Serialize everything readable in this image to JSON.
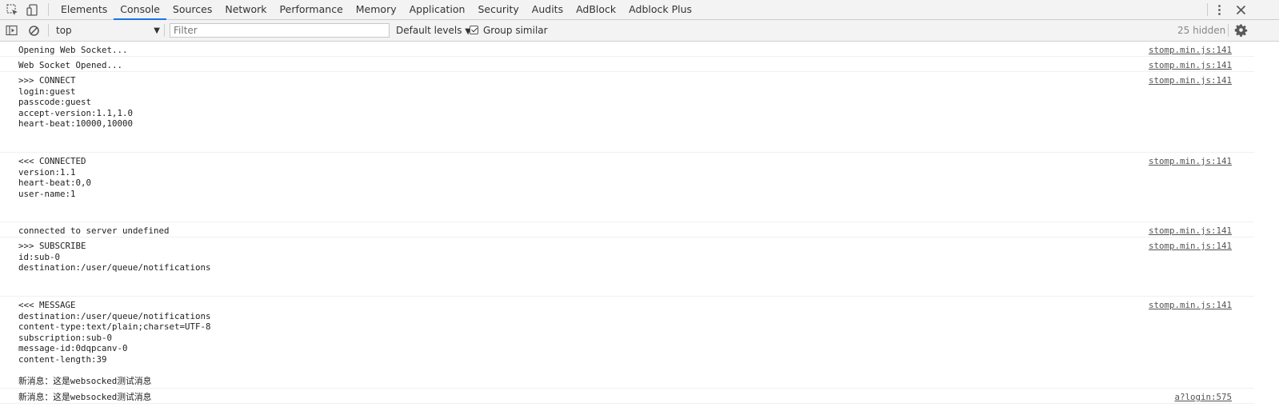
{
  "tabbar": {
    "tabs": [
      {
        "label": "Elements",
        "active": false
      },
      {
        "label": "Console",
        "active": true
      },
      {
        "label": "Sources",
        "active": false
      },
      {
        "label": "Network",
        "active": false
      },
      {
        "label": "Performance",
        "active": false
      },
      {
        "label": "Memory",
        "active": false
      },
      {
        "label": "Application",
        "active": false
      },
      {
        "label": "Security",
        "active": false
      },
      {
        "label": "Audits",
        "active": false
      },
      {
        "label": "AdBlock",
        "active": false
      },
      {
        "label": "Adblock Plus",
        "active": false
      }
    ],
    "icons": [
      "inspect-element-icon",
      "device-toolbar-icon",
      "kebab-menu-icon",
      "close-icon"
    ]
  },
  "toolbar": {
    "context": "top",
    "filter_placeholder": "Filter",
    "filter_value": "",
    "levels": "Default levels",
    "group_similar_label": "Group similar",
    "group_similar_checked": true,
    "hidden_count": "25 hidden",
    "icons": [
      "sidebar-toggle-icon",
      "clear-console-icon",
      "settings-gear-icon"
    ]
  },
  "messages": [
    {
      "text": "Opening Web Socket...",
      "source": "stomp.min.js:141"
    },
    {
      "text": "Web Socket Opened...",
      "source": "stomp.min.js:141"
    },
    {
      "text": ">>> CONNECT\nlogin:guest\npasscode:guest\naccept-version:1.1,1.0\nheart-beat:10000,10000",
      "source": "stomp.min.js:141"
    },
    {
      "text": "<<< CONNECTED\nversion:1.1\nheart-beat:0,0\nuser-name:1",
      "source": "stomp.min.js:141"
    },
    {
      "text": "connected to server undefined",
      "source": "stomp.min.js:141"
    },
    {
      "text": ">>> SUBSCRIBE\nid:sub-0\ndestination:/user/queue/notifications",
      "source": "stomp.min.js:141"
    },
    {
      "text": "<<< MESSAGE\ndestination:/user/queue/notifications\ncontent-type:text/plain;charset=UTF-8\nsubscription:sub-0\nmessage-id:0dqpcanv-0\ncontent-length:39\n\n新消息：这是websocked测试消息",
      "source": "stomp.min.js:141"
    },
    {
      "text": "新消息：这是websocked测试消息",
      "source": "a?login:575"
    }
  ]
}
